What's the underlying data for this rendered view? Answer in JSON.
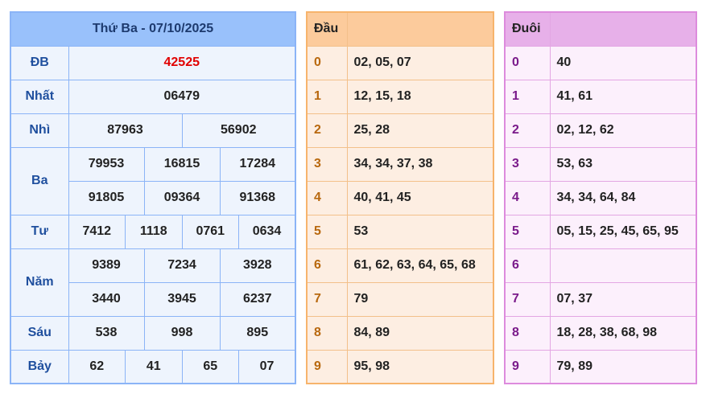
{
  "results": {
    "title": "Thứ Ba - 07/10/2025",
    "rows": [
      {
        "label": "ĐB",
        "values": [
          "42525"
        ]
      },
      {
        "label": "Nhất",
        "values": [
          "06479"
        ]
      },
      {
        "label": "Nhì",
        "values": [
          "87963",
          "56902"
        ]
      },
      {
        "label": "Ba",
        "values": [
          "79953",
          "16815",
          "17284",
          "91805",
          "09364",
          "91368"
        ]
      },
      {
        "label": "Tư",
        "values": [
          "7412",
          "1118",
          "0761",
          "0634"
        ]
      },
      {
        "label": "Năm",
        "values": [
          "9389",
          "7234",
          "3928",
          "3440",
          "3945",
          "6237"
        ]
      },
      {
        "label": "Sáu",
        "values": [
          "538",
          "998",
          "895"
        ]
      },
      {
        "label": "Bảy",
        "values": [
          "62",
          "41",
          "65",
          "07"
        ]
      }
    ]
  },
  "dau": {
    "header": "Đầu",
    "rows": [
      {
        "digit": "0",
        "values": "02, 05, 07"
      },
      {
        "digit": "1",
        "values": "12, 15, 18"
      },
      {
        "digit": "2",
        "values": "25, 28"
      },
      {
        "digit": "3",
        "values": "34, 34, 37, 38"
      },
      {
        "digit": "4",
        "values": "40, 41, 45"
      },
      {
        "digit": "5",
        "values": "53"
      },
      {
        "digit": "6",
        "values": "61, 62, 63, 64, 65, 68"
      },
      {
        "digit": "7",
        "values": "79"
      },
      {
        "digit": "8",
        "values": "84, 89"
      },
      {
        "digit": "9",
        "values": "95, 98"
      }
    ]
  },
  "duoi": {
    "header": "Đuôi",
    "rows": [
      {
        "digit": "0",
        "values": "40"
      },
      {
        "digit": "1",
        "values": "41, 61"
      },
      {
        "digit": "2",
        "values": "02, 12, 62"
      },
      {
        "digit": "3",
        "values": "53, 63"
      },
      {
        "digit": "4",
        "values": "34, 34, 64, 84"
      },
      {
        "digit": "5",
        "values": "05, 15, 25, 45, 65, 95"
      },
      {
        "digit": "6",
        "values": ""
      },
      {
        "digit": "7",
        "values": "07, 37"
      },
      {
        "digit": "8",
        "values": "18, 28, 38, 68, 98"
      },
      {
        "digit": "9",
        "values": "79, 89"
      }
    ]
  },
  "colors": {
    "special_prize": "#e10000",
    "results_border": "#8bb4f7",
    "dau_border": "#f7b46c",
    "duoi_border": "#dd8bdd"
  }
}
